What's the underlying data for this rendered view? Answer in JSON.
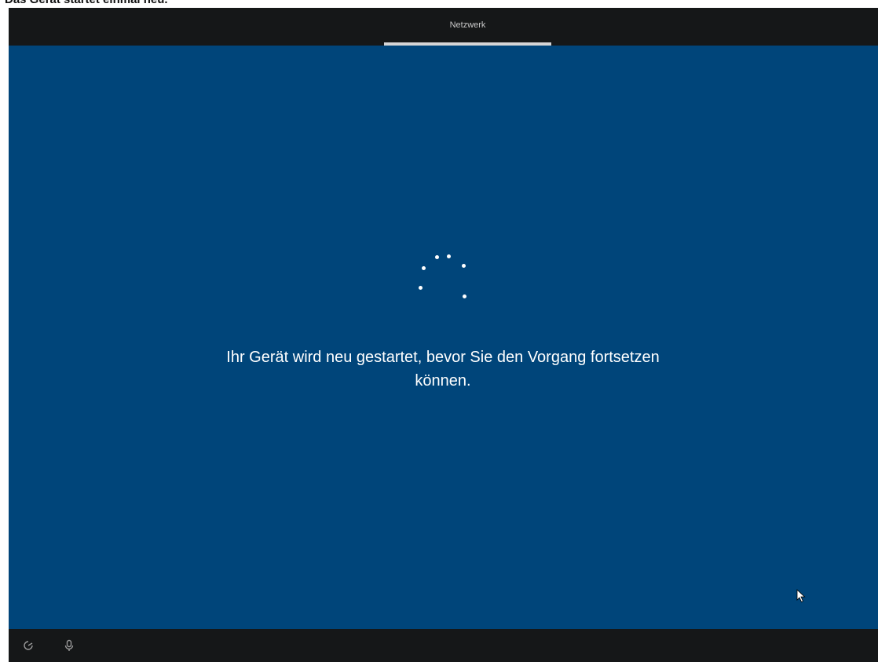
{
  "caption": {
    "text": "Das Gerät startet einmal neu."
  },
  "topbar": {
    "tab_label": "Netzwerk"
  },
  "main": {
    "message": "Ihr Gerät wird neu gestartet, bevor Sie den Vorgang fortsetzen können.",
    "spinner_icon": "loading-spinner-icon"
  },
  "bottombar": {
    "items": [
      {
        "icon": "ease-of-access-icon"
      },
      {
        "icon": "microphone-icon"
      }
    ]
  },
  "colors": {
    "background": "#00457a",
    "bars": "#151718",
    "text": "#ffffff"
  }
}
